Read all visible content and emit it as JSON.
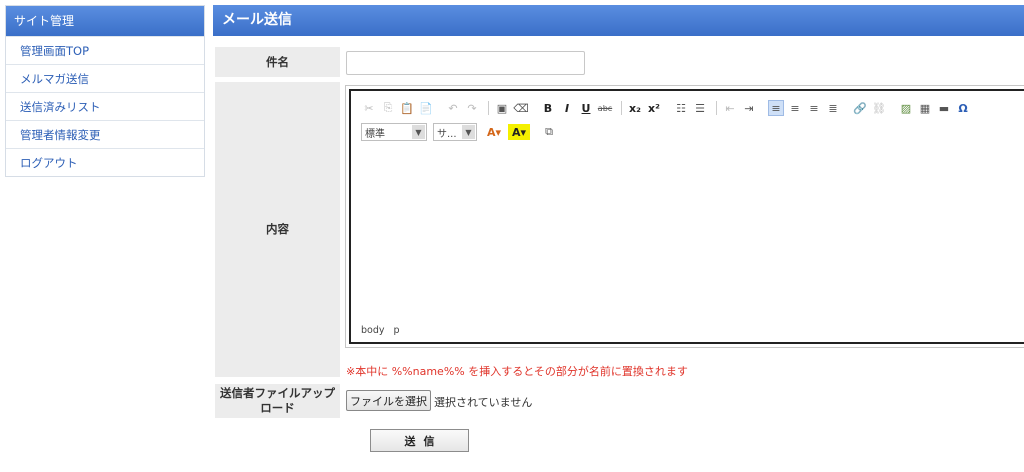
{
  "sidebar": {
    "title": "サイト管理",
    "items": [
      {
        "label": "管理画面TOP"
      },
      {
        "label": "メルマガ送信"
      },
      {
        "label": "送信済みリスト"
      },
      {
        "label": "管理者情報変更"
      },
      {
        "label": "ログアウト"
      }
    ]
  },
  "main": {
    "title": "メール送信"
  },
  "form": {
    "subject_label": "件名",
    "subject_value": "",
    "body_label": "内容",
    "editor": {
      "format_select": "標準",
      "size_select": "サ...",
      "status_path": [
        "body",
        "p"
      ]
    },
    "note": "※本中に %%name%% を挿入するとその部分が名前に置換されます",
    "file_label": "送信者ファイルアップロード",
    "file_button": "ファイルを選択",
    "file_status": "選択されていません",
    "submit": "送信"
  },
  "colors": {
    "header": "#3a6fc8",
    "link": "#2d5fb6",
    "note": "#e0342a"
  }
}
